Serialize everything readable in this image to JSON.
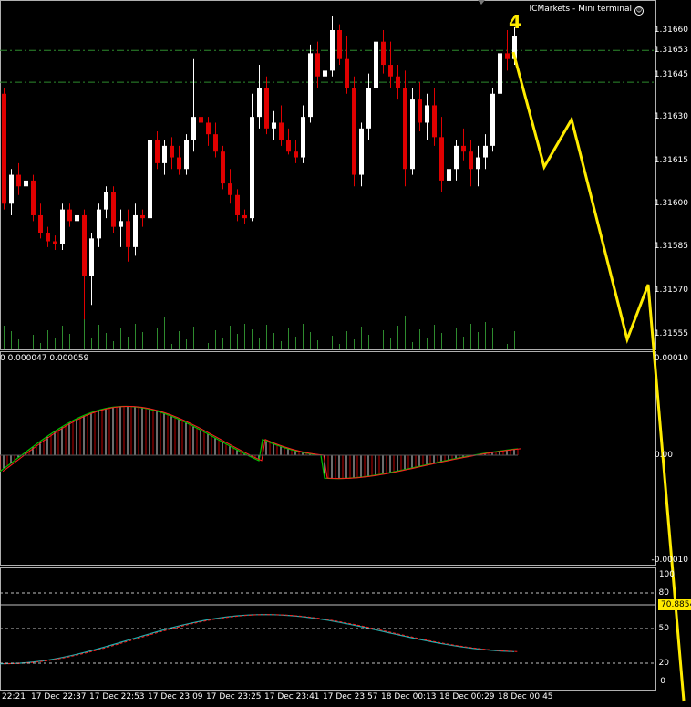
{
  "window": {
    "title": "ICMarkets - Mini terminal",
    "wave_label": "4"
  },
  "colors": {
    "background": "#000000",
    "bull_candle": "#ffffff",
    "bear_candle": "#e00000",
    "volume": "#2e8b2e",
    "level_line": "#2e8b2e",
    "macd_signal": "#00c000",
    "macd_main": "#ff2020",
    "projection": "#ffeb00",
    "stoch_main": "#20b0b0",
    "stoch_signal": "#ff2020"
  },
  "price_axis": {
    "labels": [
      "1.31660",
      "1.31653",
      "1.31645",
      "1.31630",
      "1.31615",
      "1.31600",
      "1.31585",
      "1.31570",
      "1.31555"
    ],
    "ylim": [
      1.3155,
      1.3167
    ]
  },
  "macd": {
    "values_text": "0 0.000047 0.000059",
    "axis_labels": [
      "0.00010",
      "0.00",
      "-0.00010"
    ]
  },
  "stochastic": {
    "axis_labels": [
      "100",
      "80",
      "50",
      "20",
      "0"
    ],
    "current_value": "70.8854"
  },
  "time_axis": {
    "labels": [
      "22:21",
      "17 Dec 22:37",
      "17 Dec 22:53",
      "17 Dec 23:09",
      "17 Dec 23:25",
      "17 Dec 23:41",
      "17 Dec 23:57",
      "18 Dec 00:13",
      "18 Dec 00:29",
      "18 Dec 00:45"
    ]
  },
  "chart_data": {
    "type": "candlestick",
    "levels": [
      1.31653,
      1.31642
    ],
    "candles": [
      [
        1.31638,
        1.3164,
        1.31598,
        1.316
      ],
      [
        1.316,
        1.31612,
        1.31596,
        1.3161
      ],
      [
        1.3161,
        1.31614,
        1.31603,
        1.31606
      ],
      [
        1.31606,
        1.31611,
        1.316,
        1.31608
      ],
      [
        1.31608,
        1.3161,
        1.31594,
        1.31596
      ],
      [
        1.31596,
        1.316,
        1.31588,
        1.3159
      ],
      [
        1.3159,
        1.31592,
        1.31585,
        1.31587
      ],
      [
        1.31587,
        1.31589,
        1.31584,
        1.31586
      ],
      [
        1.31586,
        1.316,
        1.31584,
        1.31598
      ],
      [
        1.31598,
        1.316,
        1.31592,
        1.31594
      ],
      [
        1.31594,
        1.31598,
        1.3159,
        1.31596
      ],
      [
        1.31596,
        1.31598,
        1.3156,
        1.31575
      ],
      [
        1.31575,
        1.3159,
        1.31565,
        1.31588
      ],
      [
        1.31588,
        1.316,
        1.31585,
        1.31598
      ],
      [
        1.31598,
        1.31606,
        1.31595,
        1.31604
      ],
      [
        1.31604,
        1.31606,
        1.3159,
        1.31592
      ],
      [
        1.31592,
        1.31598,
        1.31585,
        1.31594
      ],
      [
        1.31594,
        1.31598,
        1.3158,
        1.31585
      ],
      [
        1.31585,
        1.316,
        1.31582,
        1.31596
      ],
      [
        1.31596,
        1.31598,
        1.31592,
        1.31595
      ],
      [
        1.31595,
        1.31625,
        1.31593,
        1.31622
      ],
      [
        1.31622,
        1.31625,
        1.31612,
        1.31614
      ],
      [
        1.31614,
        1.31622,
        1.3161,
        1.3162
      ],
      [
        1.3162,
        1.31623,
        1.31612,
        1.31616
      ],
      [
        1.31616,
        1.3162,
        1.3161,
        1.31612
      ],
      [
        1.31612,
        1.31624,
        1.3161,
        1.31622
      ],
      [
        1.31622,
        1.3165,
        1.31618,
        1.3163
      ],
      [
        1.3163,
        1.31634,
        1.31624,
        1.31628
      ],
      [
        1.31628,
        1.3163,
        1.3162,
        1.31624
      ],
      [
        1.31624,
        1.31628,
        1.31616,
        1.31618
      ],
      [
        1.31618,
        1.3162,
        1.31605,
        1.31607
      ],
      [
        1.31607,
        1.31612,
        1.316,
        1.31603
      ],
      [
        1.31603,
        1.31605,
        1.31594,
        1.31596
      ],
      [
        1.31596,
        1.31598,
        1.31593,
        1.31595
      ],
      [
        1.31595,
        1.31638,
        1.31594,
        1.3163
      ],
      [
        1.3163,
        1.31648,
        1.31626,
        1.3164
      ],
      [
        1.3164,
        1.31644,
        1.31624,
        1.31626
      ],
      [
        1.31626,
        1.31632,
        1.31622,
        1.31628
      ],
      [
        1.31628,
        1.31634,
        1.3162,
        1.31622
      ],
      [
        1.31622,
        1.31626,
        1.31617,
        1.31618
      ],
      [
        1.31618,
        1.31622,
        1.31614,
        1.31616
      ],
      [
        1.31616,
        1.31634,
        1.31614,
        1.3163
      ],
      [
        1.3163,
        1.31655,
        1.31628,
        1.31652
      ],
      [
        1.31652,
        1.31656,
        1.3164,
        1.31644
      ],
      [
        1.31644,
        1.3165,
        1.31642,
        1.31646
      ],
      [
        1.31646,
        1.31665,
        1.31644,
        1.3166
      ],
      [
        1.3166,
        1.31662,
        1.31648,
        1.3165
      ],
      [
        1.3165,
        1.31658,
        1.31638,
        1.3164
      ],
      [
        1.3164,
        1.31644,
        1.31606,
        1.3161
      ],
      [
        1.3161,
        1.31628,
        1.31606,
        1.31626
      ],
      [
        1.31626,
        1.31645,
        1.31622,
        1.3164
      ],
      [
        1.3164,
        1.31662,
        1.31636,
        1.31656
      ],
      [
        1.31656,
        1.3166,
        1.31645,
        1.31648
      ],
      [
        1.31648,
        1.31656,
        1.3164,
        1.31644
      ],
      [
        1.31644,
        1.31648,
        1.31636,
        1.3164
      ],
      [
        1.3164,
        1.31646,
        1.31606,
        1.31612
      ],
      [
        1.31612,
        1.3164,
        1.3161,
        1.31636
      ],
      [
        1.31636,
        1.31642,
        1.31625,
        1.31628
      ],
      [
        1.31628,
        1.31638,
        1.31622,
        1.31634
      ],
      [
        1.31634,
        1.3164,
        1.3162,
        1.31623
      ],
      [
        1.31623,
        1.3163,
        1.31604,
        1.31608
      ],
      [
        1.31608,
        1.31616,
        1.31605,
        1.31612
      ],
      [
        1.31612,
        1.31622,
        1.31608,
        1.3162
      ],
      [
        1.3162,
        1.31626,
        1.31615,
        1.31618
      ],
      [
        1.31618,
        1.31622,
        1.31606,
        1.31612
      ],
      [
        1.31612,
        1.3162,
        1.31606,
        1.31616
      ],
      [
        1.31616,
        1.31624,
        1.31612,
        1.3162
      ],
      [
        1.3162,
        1.3164,
        1.31618,
        1.31638
      ],
      [
        1.31638,
        1.31656,
        1.31636,
        1.31652
      ],
      [
        1.31652,
        1.3166,
        1.31646,
        1.3165
      ],
      [
        1.3165,
        1.31661,
        1.31648,
        1.31658
      ]
    ],
    "projection": [
      [
        1.31653,
        0
      ],
      [
        1.31615,
        30
      ],
      [
        1.31627,
        60
      ],
      [
        1.31555,
        88
      ],
      [
        1.31572,
        113
      ],
      [
        1.315,
        155
      ]
    ]
  }
}
